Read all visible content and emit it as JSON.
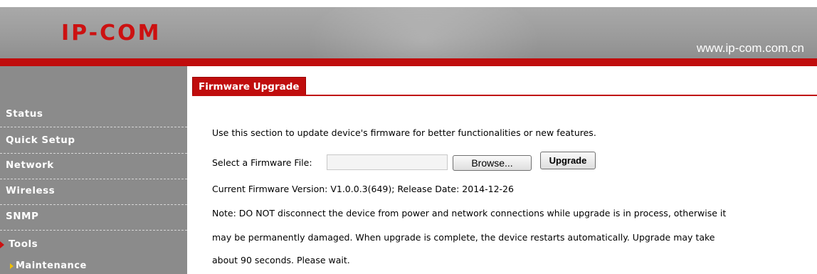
{
  "header": {
    "logo_text": "IP-COM",
    "url": "www.ip-com.com.cn"
  },
  "sidebar": {
    "items": [
      {
        "label": "Status"
      },
      {
        "label": "Quick Setup"
      },
      {
        "label": "Network"
      },
      {
        "label": "Wireless"
      },
      {
        "label": "SNMP"
      },
      {
        "label": "Tools"
      }
    ],
    "subitems": [
      {
        "label": "Maintenance"
      }
    ]
  },
  "content": {
    "tab_title": "Firmware Upgrade",
    "intro": "Use this section to update device's firmware for better functionalities or new features.",
    "select_label": "Select a Firmware File:",
    "browse_label": "Browse...",
    "upgrade_label": "Upgrade",
    "version_text": "Current Firmware Version: V1.0.0.3(649); Release Date: 2014-12-26",
    "note_line1": "Note: DO NOT disconnect the device from power and network connections while upgrade is in process, otherwise it",
    "note_line2": "may be permanently damaged. When upgrade is complete, the device restarts automatically. Upgrade may take",
    "note_line3": "about 90 seconds. Please wait."
  },
  "colors": {
    "brand_red": "#c00d0d",
    "sidebar_gray": "#8b8b8b",
    "header_gray": "#a0a0a0"
  }
}
